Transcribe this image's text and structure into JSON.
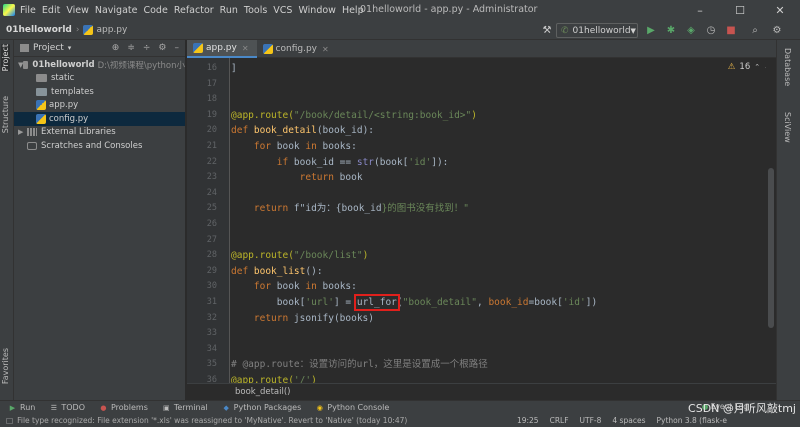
{
  "menubar": {
    "items": [
      "File",
      "Edit",
      "View",
      "Navigate",
      "Code",
      "Refactor",
      "Run",
      "Tools",
      "VCS",
      "Window",
      "Help"
    ],
    "title": "01helloworld - app.py - Administrator"
  },
  "navbar": {
    "project": "01helloworld",
    "file": "app.py",
    "run_config": "01helloworld"
  },
  "project_panel": {
    "title": "Project",
    "root": "01helloworld",
    "root_path": "D:\\视频课程\\python小",
    "items": [
      {
        "label": "static",
        "type": "folder"
      },
      {
        "label": "templates",
        "type": "folder"
      },
      {
        "label": "app.py",
        "type": "python"
      },
      {
        "label": "config.py",
        "type": "python"
      }
    ],
    "external": "External Libraries",
    "scratches": "Scratches and Consoles"
  },
  "left_tabs": {
    "project": "Project",
    "structure": "Structure",
    "favorites": "Favorites"
  },
  "right_tabs": {
    "database": "Database",
    "sciview": "SciView"
  },
  "editor": {
    "tabs": [
      {
        "label": "app.py",
        "active": true
      },
      {
        "label": "config.py",
        "active": false
      }
    ],
    "inspection_count": "16",
    "line_numbers": [
      "16",
      "17",
      "18",
      "19",
      "20",
      "21",
      "22",
      "23",
      "24",
      "25",
      "26",
      "27",
      "28",
      "29",
      "30",
      "31",
      "32",
      "33",
      "34",
      "35",
      "36"
    ],
    "lines": [
      {
        "t": "]",
        "cls": ""
      },
      {
        "t": "",
        "cls": ""
      },
      {
        "t": "",
        "cls": ""
      },
      {
        "parts": [
          [
            "@app.route(",
            "dec"
          ],
          [
            "\"/book/detail/<string:book_id>\"",
            "str"
          ],
          [
            ")",
            "dec"
          ]
        ]
      },
      {
        "parts": [
          [
            "def ",
            "kw"
          ],
          [
            "book_detail",
            "fn"
          ],
          [
            "(book_id):",
            ""
          ]
        ]
      },
      {
        "parts": [
          [
            "    for ",
            "kw"
          ],
          [
            "book ",
            ""
          ],
          [
            "in ",
            "kw"
          ],
          [
            "books:",
            ""
          ]
        ]
      },
      {
        "parts": [
          [
            "        if ",
            "kw"
          ],
          [
            "book_id == ",
            ""
          ],
          [
            "str",
            "builtin"
          ],
          [
            "(book[",
            ""
          ],
          [
            "'id'",
            "str"
          ],
          [
            "]):",
            ""
          ]
        ]
      },
      {
        "parts": [
          [
            "            return ",
            "kw"
          ],
          [
            "book",
            ""
          ]
        ]
      },
      {
        "t": "",
        "cls": ""
      },
      {
        "parts": [
          [
            "    return ",
            "kw"
          ],
          [
            "f\"id为：{",
            ""
          ],
          [
            "book_id",
            ""
          ],
          [
            "}的图书没有找到！\"",
            "str"
          ]
        ]
      },
      {
        "t": "",
        "cls": ""
      },
      {
        "t": "",
        "cls": ""
      },
      {
        "parts": [
          [
            "@app.route(",
            "dec"
          ],
          [
            "\"/book/list\"",
            "str"
          ],
          [
            ")",
            "dec"
          ]
        ]
      },
      {
        "parts": [
          [
            "def ",
            "kw"
          ],
          [
            "book_list",
            "fn"
          ],
          [
            "():",
            ""
          ]
        ]
      },
      {
        "parts": [
          [
            "    for ",
            "kw"
          ],
          [
            "book ",
            ""
          ],
          [
            "in ",
            "kw"
          ],
          [
            "books:",
            ""
          ]
        ]
      },
      {
        "parts": [
          [
            "        book[",
            ""
          ],
          [
            "'url'",
            "str"
          ],
          [
            "] = ",
            ""
          ],
          [
            "url_for",
            ""
          ],
          [
            "(",
            ""
          ],
          [
            "\"book_detail\"",
            "str"
          ],
          [
            ", ",
            ""
          ],
          [
            "book_id",
            "kw"
          ],
          [
            "=book[",
            ""
          ],
          [
            "'id'",
            "str"
          ],
          [
            "])",
            ""
          ]
        ]
      },
      {
        "parts": [
          [
            "    return ",
            "kw"
          ],
          [
            "jsonify(books)",
            ""
          ]
        ]
      },
      {
        "t": "",
        "cls": ""
      },
      {
        "t": "",
        "cls": ""
      },
      {
        "parts": [
          [
            "# @app.route：设置访问的url，这里是设置成一个根路径",
            "cmt"
          ]
        ]
      },
      {
        "parts": [
          [
            "@app.route(",
            "dec"
          ],
          [
            "'/'",
            "str"
          ],
          [
            ")",
            "dec"
          ]
        ]
      }
    ],
    "breadcrumb": "book_detail()"
  },
  "toolwindows": [
    "Run",
    "TODO",
    "Problems",
    "Terminal",
    "Python Packages",
    "Python Console"
  ],
  "status": {
    "message": "File type recognized: File extension '*.xls' was reassigned to 'MyNative'. Revert to 'Native' (today 10:47)",
    "position": "19:25",
    "line_sep": "CRLF",
    "encoding": "UTF-8",
    "indent": "4 spaces",
    "interpreter": "Python 3.8 (flask-e",
    "event_log": "Event Log"
  },
  "watermark": "CSDN @月听风敲tmj"
}
